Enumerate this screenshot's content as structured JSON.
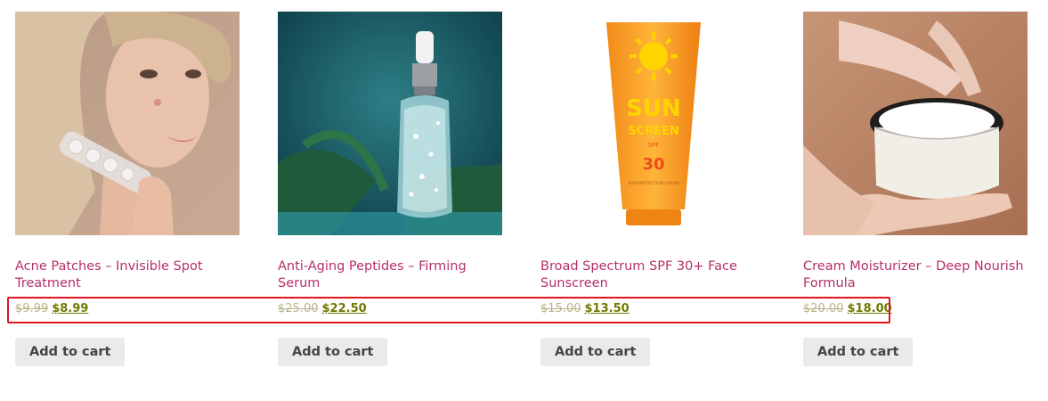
{
  "products": [
    {
      "title": "Acne Patches – Invisible Spot Treatment",
      "old_price": "$9.99",
      "new_price": "$8.99",
      "button": "Add to cart"
    },
    {
      "title": "Anti-Aging Peptides – Firming Serum",
      "old_price": "$25.00",
      "new_price": "$22.50",
      "button": "Add to cart"
    },
    {
      "title": "Broad Spectrum SPF 30+ Face Sunscreen",
      "old_price": "$15.00",
      "new_price": "$13.50",
      "button": "Add to cart"
    },
    {
      "title": "Cream Moisturizer – Deep Nourish Formula",
      "old_price": "$20.00",
      "new_price": "$18.00",
      "button": "Add to cart"
    }
  ],
  "sunscreen_label": {
    "sun": "SUN",
    "screen": "SCREEN",
    "spf": "SPF",
    "spf_value": "30",
    "small": "SUN PROTECTION CREAM"
  },
  "colors": {
    "title": "#b5306a",
    "new_price": "#6f7a00",
    "old_price": "#b7b38a",
    "button_bg": "#ebe9eb",
    "highlight": "#e0161c"
  }
}
